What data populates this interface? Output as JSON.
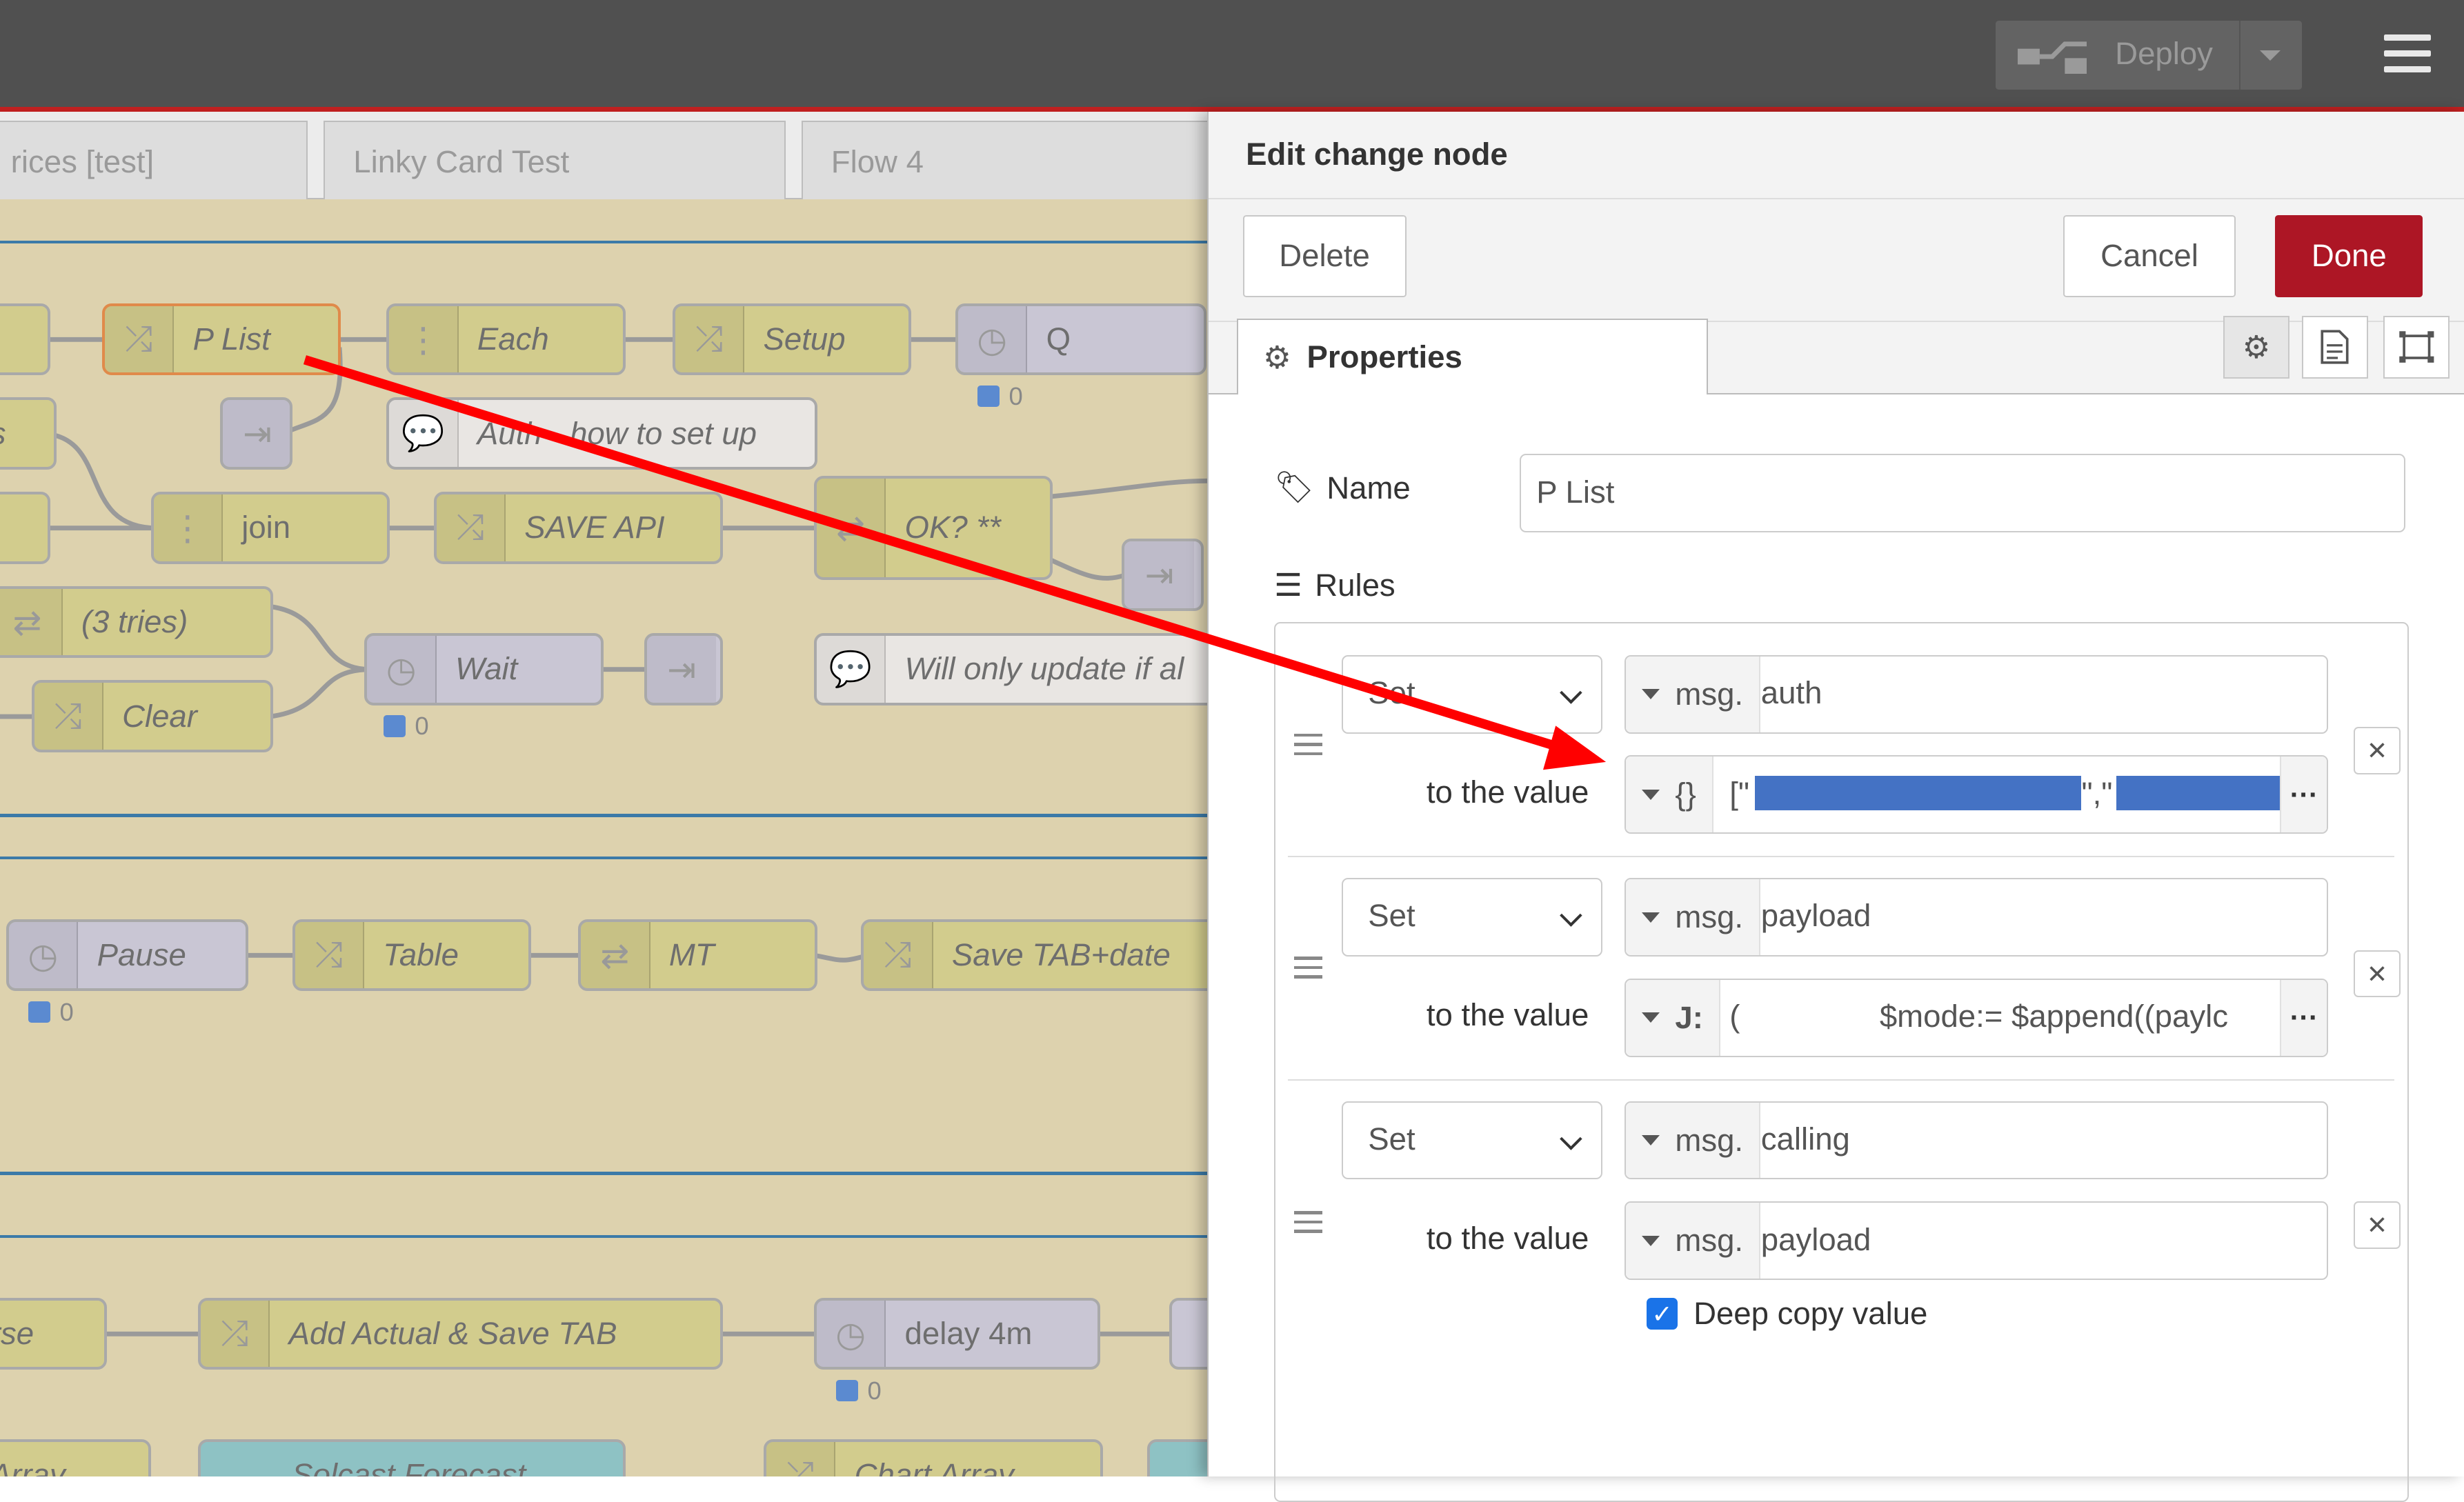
{
  "header": {
    "deploy_label": "Deploy"
  },
  "workspace": {
    "tabs": [
      "rices [test]",
      "Linky Card Test",
      "Flow 4"
    ],
    "nodes": {
      "p_list": "P List",
      "each": "Each",
      "setup": "Setup",
      "q": "Q",
      "auth_comment": "Auth - how to set up",
      "join": "join",
      "save_api": "SAVE API",
      "ok": "OK? **",
      "tries": "(3 tries)",
      "clear": "Clear",
      "wait": "Wait",
      "will_update": "Will only update if al",
      "pause": "Pause",
      "table": "Table",
      "mt": "MT",
      "save_tab": "Save TAB+date",
      "rse": "rse",
      "add_actual": "Add Actual & Save TAB",
      "delay": "delay 4m",
      "array": "Array",
      "solcast": "Solcast Forecast",
      "chart_array": "Chart Array",
      "s_stub": "s"
    },
    "status_counts": {
      "q": "0",
      "wait": "0",
      "pause": "0",
      "delay": "0"
    }
  },
  "tray": {
    "title": "Edit change node",
    "delete_label": "Delete",
    "cancel_label": "Cancel",
    "done_label": "Done",
    "properties_tab": "Properties",
    "name_label": "Name",
    "name_value": "P List",
    "rules_label": "Rules",
    "to_the_value": "to the value",
    "rules": [
      {
        "action": "Set",
        "target_type": "msg.",
        "target": "auth",
        "value_type": "{}",
        "value": "[\""
      },
      {
        "action": "Set",
        "target_type": "msg.",
        "target": "payload",
        "value_type": "J:",
        "value": "(                $mode:= $append((paylc"
      },
      {
        "action": "Set",
        "target_type": "msg.",
        "target": "calling",
        "value_type": "msg.",
        "value": "payload"
      }
    ],
    "deep_copy_label": "Deep copy value",
    "deep_copy_checked": true
  },
  "colors": {
    "done": "#ad1625",
    "header": "#505050",
    "annotation_arrow": "#ff0000",
    "redaction": "#4472c4"
  }
}
